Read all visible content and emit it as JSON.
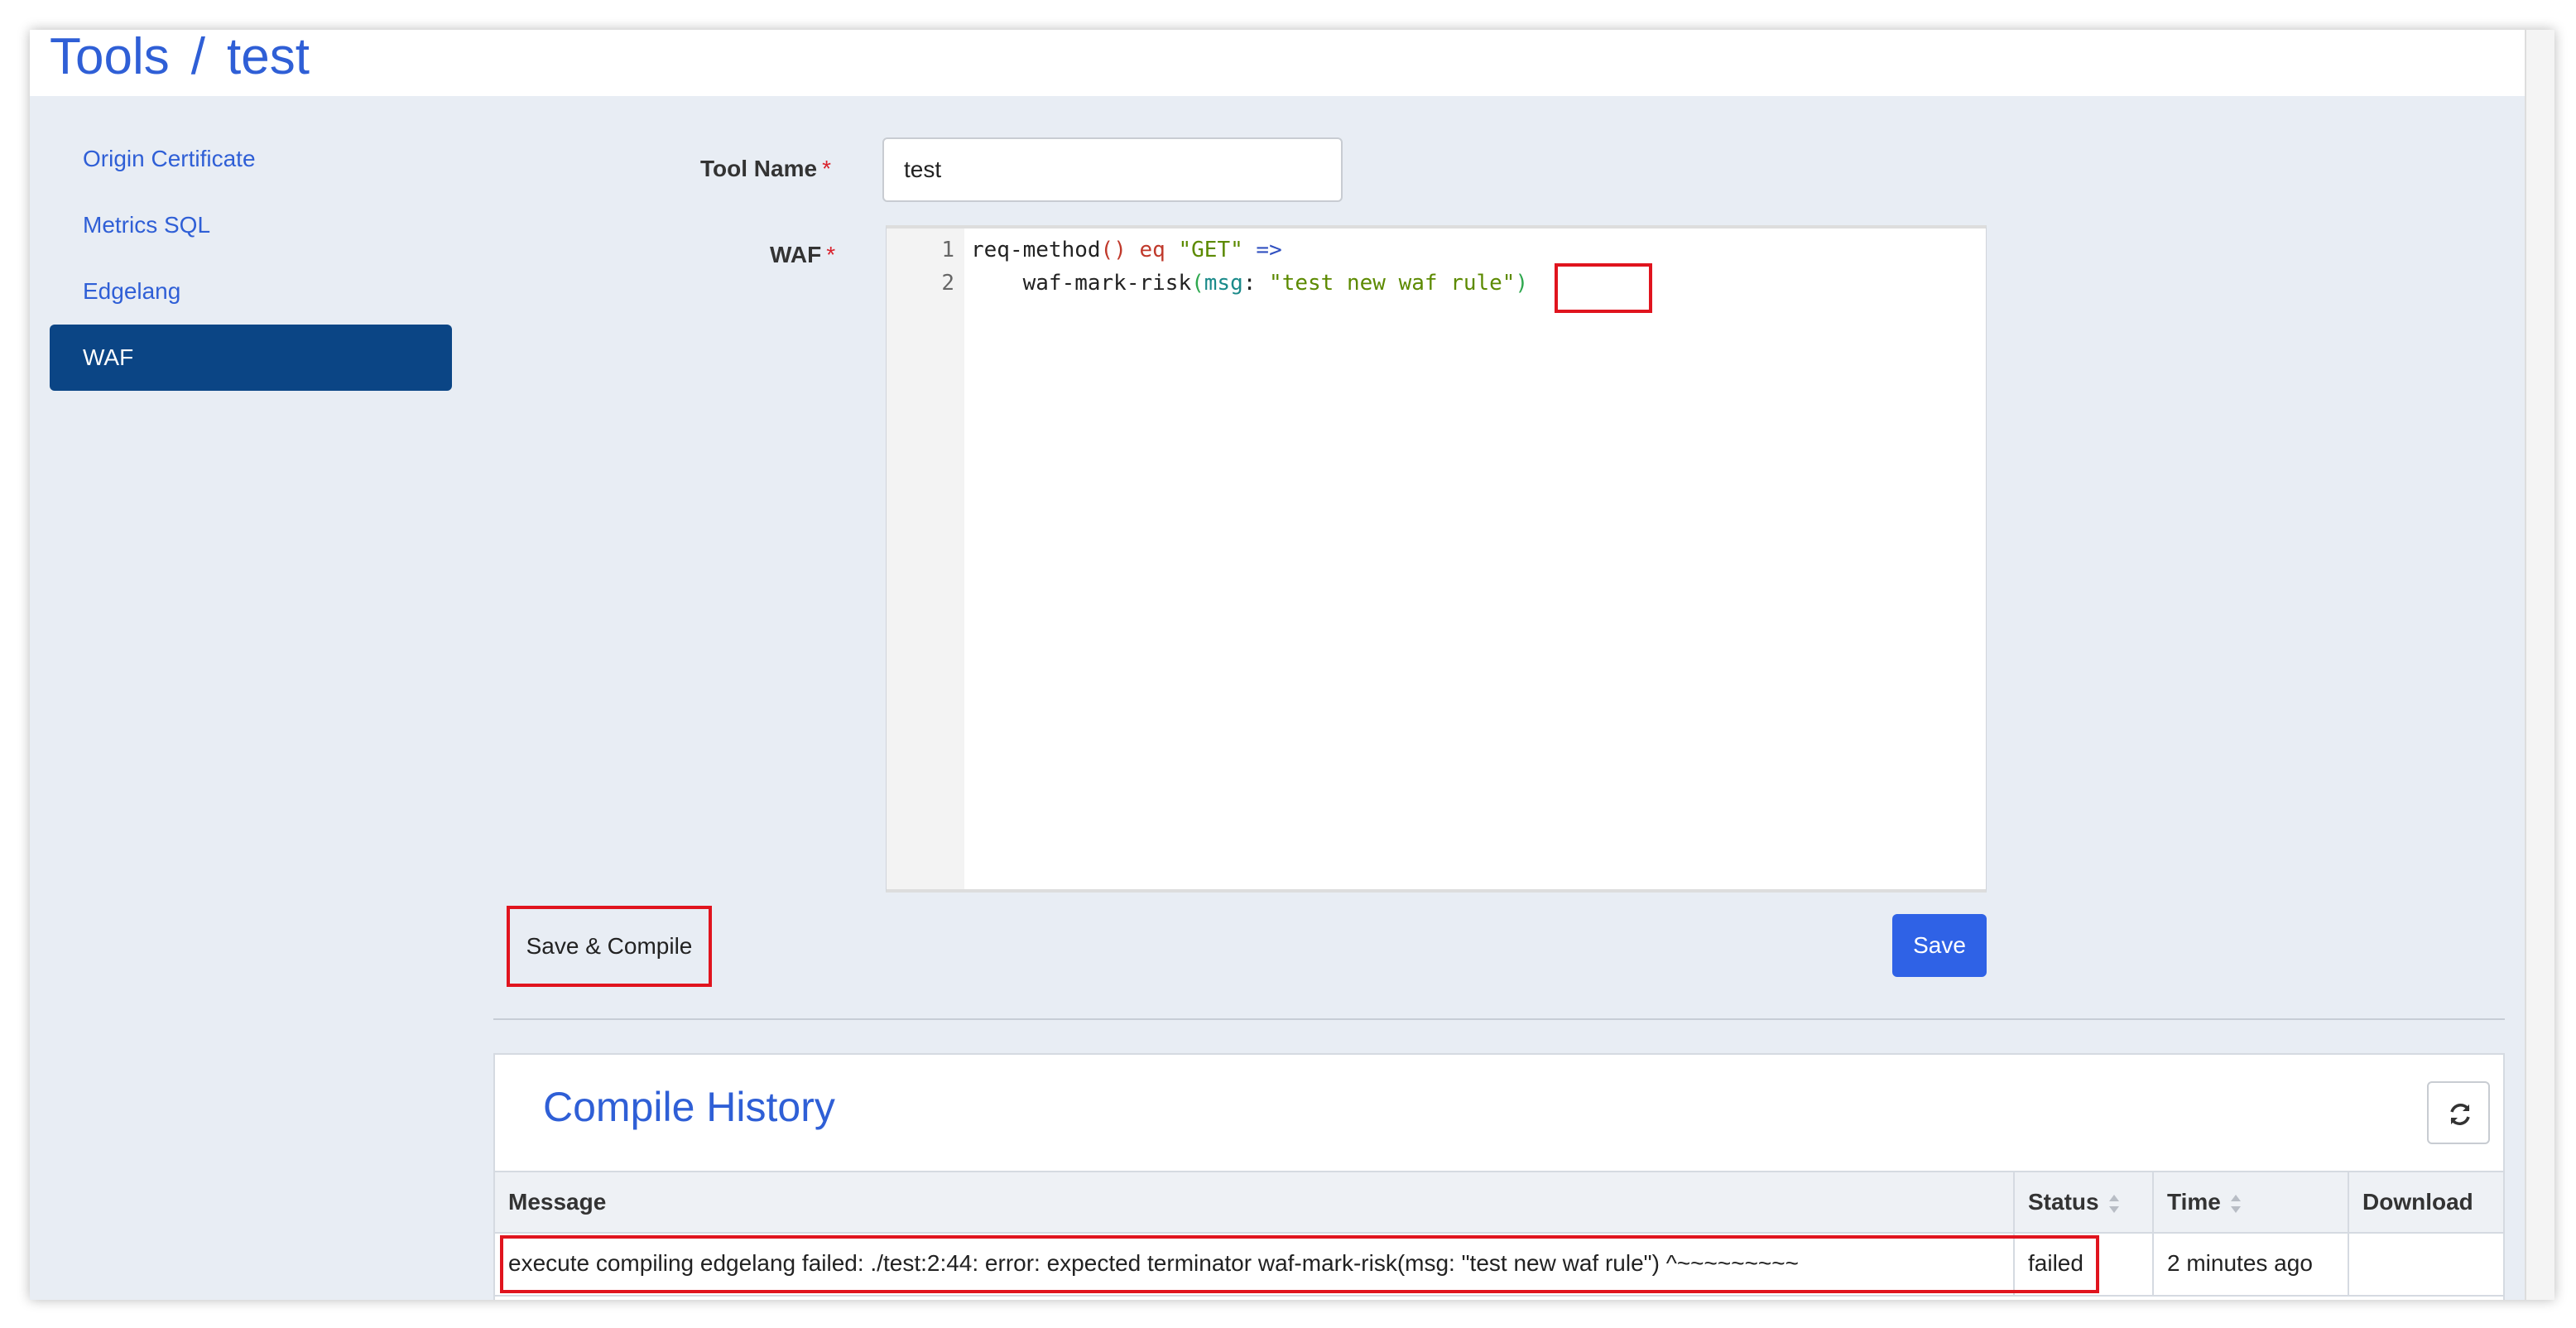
{
  "header": {
    "section": "Tools",
    "separator": "/",
    "item": "test"
  },
  "sidebar": {
    "items": [
      {
        "label": "Origin Certificate",
        "active": false
      },
      {
        "label": "Metrics SQL",
        "active": false
      },
      {
        "label": "Edgelang",
        "active": false
      },
      {
        "label": "WAF",
        "active": true
      }
    ]
  },
  "form": {
    "tool_name_label": "Tool Name",
    "tool_name_value": "test",
    "waf_label": "WAF",
    "required_mark": "*",
    "code": {
      "lines": [
        {
          "number": "1",
          "tokens": [
            "req-method",
            "()",
            " eq ",
            "\"GET\"",
            " =>"
          ]
        },
        {
          "number": "2",
          "tokens": [
            "    waf-mark-risk",
            "(",
            "msg",
            ": ",
            "\"test new waf rule\"",
            ")"
          ]
        }
      ]
    },
    "save_compile_label": "Save & Compile",
    "save_label": "Save"
  },
  "compile_history": {
    "title": "Compile History",
    "columns": [
      "Message",
      "Status",
      "Time",
      "Download"
    ],
    "rows": [
      {
        "message": "execute compiling edgelang failed: ./test:2:44: error: expected terminator waf-mark-risk(msg: \"test new waf rule\") ^~~~~~~~~~",
        "status": "failed",
        "time": "2 minutes ago",
        "download": ""
      }
    ]
  },
  "colors": {
    "accent": "#2f5fd6",
    "sidebar_active": "#0b4585",
    "primary_button": "#2f62e6",
    "highlight": "#e0141e",
    "required": "#d9232d"
  },
  "icons": {
    "refresh": "refresh-icon",
    "sort": "sort-icon"
  }
}
